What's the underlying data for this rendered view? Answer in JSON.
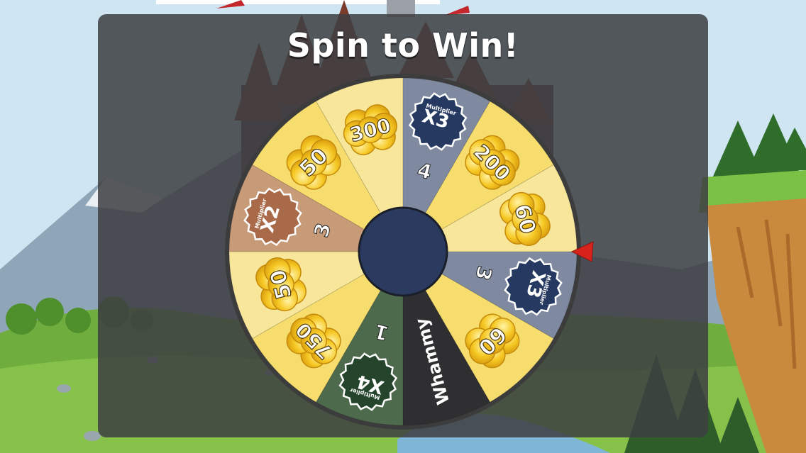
{
  "title": "Spin to Win!",
  "colors": {
    "sky": "#cfe6f2",
    "overlay": "#3e3f42",
    "hub": "#2b3a5f",
    "wheel_rim": "#3c3c3c",
    "pointer": "#d8231c",
    "yellow": "#f7dd6e",
    "yellow_light": "#f8e79a",
    "slate": "#7f8aa0",
    "dark": "#2f2f31",
    "green": "#4e6a4c",
    "tan": "#c79a78",
    "coin": "#f4c21a",
    "badge_x3": "#263a61",
    "badge_x4": "#24442c",
    "badge_x2": "#a86a48"
  },
  "wheel": {
    "segments": [
      {
        "kind": "coin",
        "value": "200",
        "color": "yellow"
      },
      {
        "kind": "coin",
        "value": "60",
        "color": "yellow_light"
      },
      {
        "kind": "multiplier",
        "count": "3",
        "badge": "X3",
        "badge_sub": "Multiplier",
        "badge_color": "badge_x3",
        "color": "slate"
      },
      {
        "kind": "coin",
        "value": "60",
        "color": "yellow"
      },
      {
        "kind": "whammy",
        "label": "Whammy",
        "color": "dark"
      },
      {
        "kind": "multiplier",
        "count": "1",
        "badge": "X4",
        "badge_sub": "Multiplier",
        "badge_color": "badge_x4",
        "color": "green"
      },
      {
        "kind": "coin",
        "value": "750",
        "color": "yellow"
      },
      {
        "kind": "coin",
        "value": "50",
        "color": "yellow_light"
      },
      {
        "kind": "multiplier",
        "count": "3",
        "badge": "X2",
        "badge_sub": "Multiplier",
        "badge_color": "badge_x2",
        "color": "tan"
      },
      {
        "kind": "coin",
        "value": "50",
        "color": "yellow"
      },
      {
        "kind": "coin",
        "value": "300",
        "color": "yellow_light"
      },
      {
        "kind": "multiplier",
        "count": "4",
        "badge": "X3",
        "badge_sub": "Multiplier",
        "badge_color": "badge_x3",
        "color": "slate"
      }
    ]
  }
}
